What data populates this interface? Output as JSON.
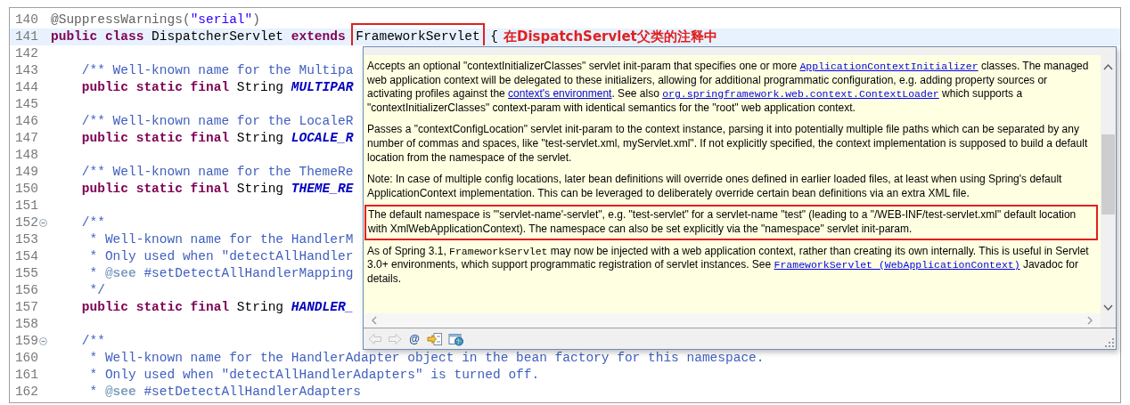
{
  "editor": {
    "lines": [
      {
        "number": "140",
        "fold": false,
        "current": false,
        "kind": "top",
        "tokens": [
          {
            "kind": "annotation",
            "text": "@SuppressWarnings("
          },
          {
            "kind": "string",
            "text": "\"serial\""
          },
          {
            "kind": "annotation",
            "text": ")"
          }
        ]
      },
      {
        "number": "141",
        "fold": false,
        "current": true,
        "kind": "top",
        "tokens": [
          {
            "kind": "keyword",
            "text": "public class"
          },
          {
            "kind": "plain",
            "text": " DispatcherServlet "
          },
          {
            "kind": "keyword",
            "text": "extends"
          },
          {
            "kind": "boxed",
            "text": "FrameworkServlet"
          },
          {
            "kind": "plain",
            "text": " {"
          }
        ]
      },
      {
        "number": "142",
        "fold": false,
        "current": false,
        "kind": "top"
      },
      {
        "number": "143",
        "fold": false,
        "current": false,
        "kind": "member",
        "tokens": [
          {
            "kind": "javadoc",
            "text": "/** Well-known name for the Multipa"
          }
        ]
      },
      {
        "number": "144",
        "fold": false,
        "current": false,
        "kind": "member",
        "tokens": [
          {
            "kind": "keyword",
            "text": "public static final"
          },
          {
            "kind": "plain",
            "text": " String "
          },
          {
            "kind": "constant",
            "text": "MULTIPAR"
          }
        ]
      },
      {
        "number": "145",
        "fold": false,
        "current": false,
        "kind": "top"
      },
      {
        "number": "146",
        "fold": false,
        "current": false,
        "kind": "member",
        "tokens": [
          {
            "kind": "javadoc",
            "text": "/** Well-known name for the LocaleR"
          }
        ]
      },
      {
        "number": "147",
        "fold": false,
        "current": false,
        "kind": "member",
        "tokens": [
          {
            "kind": "keyword",
            "text": "public static final"
          },
          {
            "kind": "plain",
            "text": " String "
          },
          {
            "kind": "constant",
            "text": "LOCALE_R"
          }
        ]
      },
      {
        "number": "148",
        "fold": false,
        "current": false,
        "kind": "top"
      },
      {
        "number": "149",
        "fold": false,
        "current": false,
        "kind": "member",
        "tokens": [
          {
            "kind": "javadoc",
            "text": "/** Well-known name for the ThemeRe"
          }
        ]
      },
      {
        "number": "150",
        "fold": false,
        "current": false,
        "kind": "member",
        "tokens": [
          {
            "kind": "keyword",
            "text": "public static final"
          },
          {
            "kind": "plain",
            "text": " String "
          },
          {
            "kind": "constant",
            "text": "THEME_RE"
          }
        ]
      },
      {
        "number": "151",
        "fold": false,
        "current": false,
        "kind": "top"
      },
      {
        "number": "152",
        "fold": true,
        "current": false,
        "kind": "member",
        "tokens": [
          {
            "kind": "javadoc",
            "text": "/**"
          }
        ]
      },
      {
        "number": "153",
        "fold": false,
        "current": false,
        "kind": "doc",
        "tokens": [
          {
            "kind": "javadoc",
            "text": "* Well-known name for the HandlerM"
          }
        ]
      },
      {
        "number": "154",
        "fold": false,
        "current": false,
        "kind": "doc",
        "tokens": [
          {
            "kind": "javadoc",
            "text": "* Only used when \"detectAllHandler"
          }
        ]
      },
      {
        "number": "155",
        "fold": false,
        "current": false,
        "kind": "doc",
        "tokens": [
          {
            "kind": "javadoc",
            "text": "* "
          },
          {
            "kind": "tag",
            "text": "@see"
          },
          {
            "kind": "javadoc",
            "text": " #setDetectAllHandlerMapping"
          }
        ]
      },
      {
        "number": "156",
        "fold": false,
        "current": false,
        "kind": "doc",
        "tokens": [
          {
            "kind": "javadoc",
            "text": "*/"
          }
        ]
      },
      {
        "number": "157",
        "fold": false,
        "current": false,
        "kind": "member",
        "tokens": [
          {
            "kind": "keyword",
            "text": "public static final"
          },
          {
            "kind": "plain",
            "text": " String "
          },
          {
            "kind": "constant",
            "text": "HANDLER_"
          }
        ]
      },
      {
        "number": "158",
        "fold": false,
        "current": false,
        "kind": "top"
      },
      {
        "number": "159",
        "fold": true,
        "current": false,
        "kind": "member",
        "tokens": [
          {
            "kind": "javadoc",
            "text": "/**"
          }
        ]
      },
      {
        "number": "160",
        "fold": false,
        "current": false,
        "kind": "doc",
        "tokens": [
          {
            "kind": "javadoc",
            "text": "* Well-known name for the HandlerAdapter object in the bean factory for this namespace."
          }
        ]
      },
      {
        "number": "161",
        "fold": false,
        "current": false,
        "kind": "doc",
        "tokens": [
          {
            "kind": "javadoc",
            "text": "* Only used when \"detectAllHandlerAdapters\" is turned off."
          }
        ]
      },
      {
        "number": "162",
        "fold": false,
        "current": false,
        "kind": "doc",
        "tokens": [
          {
            "kind": "javadoc",
            "text": "* "
          },
          {
            "kind": "tag",
            "text": "@see"
          },
          {
            "kind": "javadoc",
            "text": " #setDetectAllHandlerAdapters"
          }
        ]
      }
    ]
  },
  "annotation": {
    "text": "在DispatchServlet父类的注释中"
  },
  "javadoc_popup": {
    "paragraphs": [
      {
        "highlighted": false,
        "segments": [
          {
            "kind": "text",
            "text": "Accepts an optional \"contextInitializerClasses\" servlet init-param that specifies one or more "
          },
          {
            "kind": "code_link",
            "text": "ApplicationContextInitializer"
          },
          {
            "kind": "text",
            "text": " classes. The managed web application context will be delegated to these initializers, allowing for additional programmatic configuration, e.g. adding property sources or activating profiles against the "
          },
          {
            "kind": "link",
            "text": "context's environment"
          },
          {
            "kind": "text",
            "text": ". See also "
          },
          {
            "kind": "code_link",
            "text": "org.springframework.web.context.ContextLoader"
          },
          {
            "kind": "text",
            "text": " which supports a \"contextInitializerClasses\" context-param with identical semantics for the \"root\" web application context."
          }
        ]
      },
      {
        "highlighted": false,
        "segments": [
          {
            "kind": "text",
            "text": "Passes a \"contextConfigLocation\" servlet init-param to the context instance, parsing it into potentially multiple file paths which can be separated by any number of commas and spaces, like \"test-servlet.xml, myServlet.xml\". If not explicitly specified, the context implementation is supposed to build a default location from the namespace of the servlet."
          }
        ]
      },
      {
        "highlighted": false,
        "segments": [
          {
            "kind": "text",
            "text": "Note: In case of multiple config locations, later bean definitions will override ones defined in earlier loaded files, at least when using Spring's default ApplicationContext implementation. This can be leveraged to deliberately override certain bean definitions via an extra XML file."
          }
        ]
      },
      {
        "highlighted": true,
        "segments": [
          {
            "kind": "text",
            "text": "The default namespace is \"'servlet-name'-servlet\", e.g. \"test-servlet\" for a servlet-name \"test\" (leading to a \"/WEB-INF/test-servlet.xml\" default location with XmlWebApplicationContext). The namespace can also be set explicitly via the \"namespace\" servlet init-param."
          }
        ]
      },
      {
        "highlighted": false,
        "segments": [
          {
            "kind": "text",
            "text": "As of Spring 3.1, "
          },
          {
            "kind": "code",
            "text": "FrameworkServlet"
          },
          {
            "kind": "text",
            "text": " may now be injected with a web application context, rather than creating its own internally. This is useful in Servlet 3.0+ environments, which support programmatic registration of servlet instances. See "
          },
          {
            "kind": "code_link",
            "text": "FrameworkServlet (WebApplicationContext)"
          },
          {
            "kind": "text",
            "text": " Javadoc for details."
          }
        ]
      }
    ],
    "toolbar": [
      {
        "kind": "back",
        "disabled": true
      },
      {
        "kind": "forward",
        "disabled": true
      },
      {
        "kind": "at",
        "label": "@",
        "disabled": false
      },
      {
        "kind": "open_declaration",
        "disabled": false
      },
      {
        "kind": "open_browser",
        "disabled": false
      }
    ]
  }
}
